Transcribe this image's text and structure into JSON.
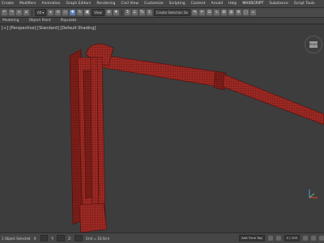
{
  "menu": {
    "items": [
      "Create",
      "Modifiers",
      "Animation",
      "Graph Editors",
      "Rendering",
      "Civil View",
      "Customize",
      "Scripting",
      "Content",
      "Arnold",
      "Help",
      "MAXSCRIPT",
      "Substance",
      "Script Tools"
    ]
  },
  "toolbar": {
    "selection_set_placeholder": "Create Selection Se",
    "coord_system": "View"
  },
  "ribbon": {
    "tabs": [
      "Modeling",
      "Object Paint",
      "Populate"
    ]
  },
  "viewport": {
    "label": "[+] [Perspective] [Standard] [Default Shading]",
    "viewcube_face": "FRONT",
    "object_color": "#9e2a24",
    "wire_color": "#5a1210"
  },
  "status": {
    "selection": "1 Object Selected",
    "x_label": "X:",
    "y_label": "Y:",
    "z_label": "Z:",
    "grid": "Grid = 10,0cm",
    "add_time_tag": "Add Time Tag",
    "frame_counter": "0 / 100"
  },
  "colors": {
    "accent": "#5b7fb0",
    "viewport_bg": "#3d3d3d"
  }
}
